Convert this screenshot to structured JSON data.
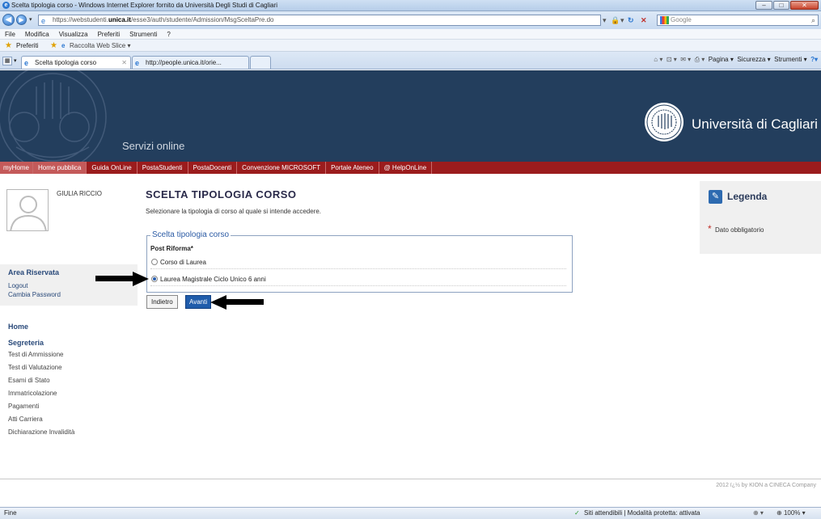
{
  "window": {
    "title": "Scelta tipologia corso - Windows Internet Explorer fornito da Università Degli Studi di Cagliari"
  },
  "address": {
    "url_prefix": "https://webstudenti.",
    "url_domain": "unica.it",
    "url_rest": "/esse3/auth/studente/Admission/MsgSceltaPre.do"
  },
  "search": {
    "placeholder": "Google"
  },
  "menu": [
    "File",
    "Modifica",
    "Visualizza",
    "Preferiti",
    "Strumenti",
    "?"
  ],
  "favorites": {
    "label": "Preferiti",
    "slice": "Raccolta Web Slice ▾"
  },
  "tabs": [
    {
      "label": "Scelta tipologia corso"
    },
    {
      "label": "http://people.unica.it/orie..."
    }
  ],
  "commandbar": {
    "pagina": "Pagina ▾",
    "sicurezza": "Sicurezza ▾",
    "strumenti": "Strumenti ▾"
  },
  "header": {
    "servizi": "Servizi online",
    "university": "Università di Cagliari"
  },
  "topnav": [
    "myHome",
    "Home pubblica",
    "Guida OnLine",
    "PostaStudenti",
    "PostaDocenti",
    "Convenzione MICROSOFT",
    "Portale Ateneo",
    "@ HelpOnLine"
  ],
  "user": {
    "name": "GIULIA RICCIO"
  },
  "area": {
    "title": "Area Riservata",
    "logout": "Logout",
    "password": "Cambia Password"
  },
  "sidebar": {
    "home": "Home",
    "segreteria": "Segreteria",
    "items": [
      "Test di Ammissione",
      "Test di Valutazione",
      "Esami di Stato",
      "Immatricolazione",
      "Pagamenti",
      "Atti Carriera",
      "Dichiarazione Invalidità"
    ]
  },
  "main": {
    "title": "SCELTA TIPOLOGIA CORSO",
    "intro": "Selezionare la tipologia di corso al quale si intende accedere.",
    "fieldset_legend": "Scelta tipologia corso",
    "group_label": "Post Riforma*",
    "options": [
      {
        "label": "Corso di Laurea",
        "selected": false
      },
      {
        "label": "Laurea Magistrale Ciclo Unico 6 anni",
        "selected": true
      }
    ],
    "back": "Indietro",
    "next": "Avanti"
  },
  "legenda": {
    "title": "Legenda",
    "required": "Dato obbligatorio"
  },
  "footer": {
    "copyright": "2012 ï¿½ by KION a CINECA Company"
  },
  "status": {
    "left": "Fine",
    "zone": "Siti attendibili | Modalità protetta: attivata",
    "zoom": "100%"
  }
}
